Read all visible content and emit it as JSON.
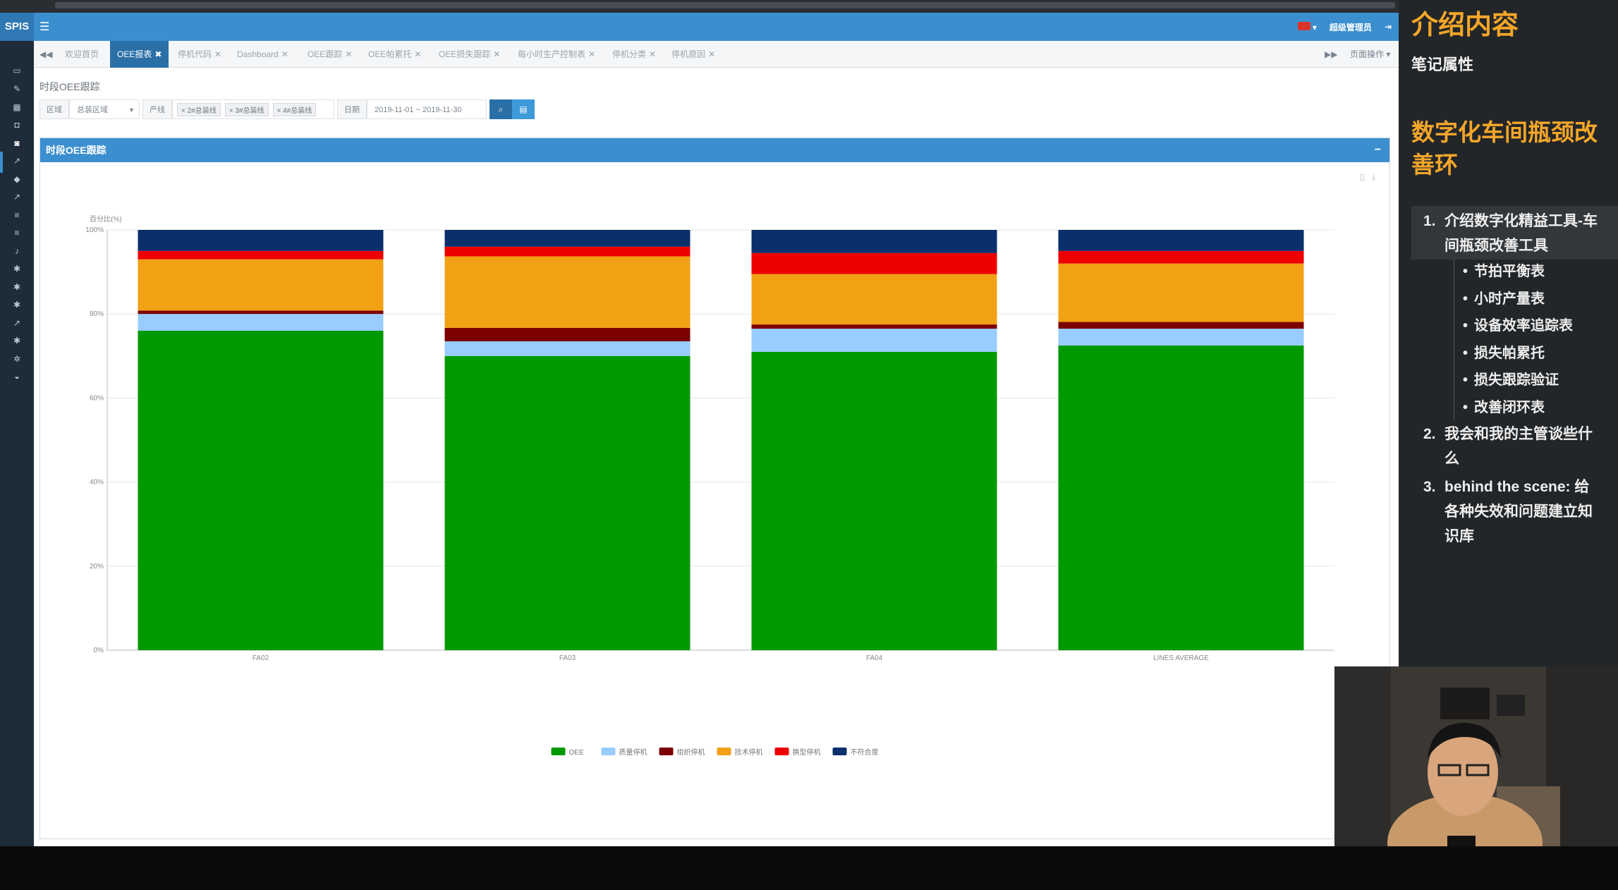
{
  "header": {
    "logo": "SPIS",
    "user": "超级管理员",
    "menu_icon": "menu-icon",
    "logout_icon": "logout-icon",
    "flag_color": "#d9342b"
  },
  "tabs": [
    {
      "label": "欢迎首页",
      "active": false
    },
    {
      "label": "OEE报表",
      "active": true
    },
    {
      "label": "停机代码",
      "active": false
    },
    {
      "label": "Dashboard",
      "active": false
    },
    {
      "label": "OEE跟踪",
      "active": false
    },
    {
      "label": "OEE帕累托",
      "active": false
    },
    {
      "label": "OEE损失跟踪",
      "active": false
    },
    {
      "label": "每小时生产控制表",
      "active": false
    },
    {
      "label": "停机分类",
      "active": false
    },
    {
      "label": "停机原因",
      "active": false
    }
  ],
  "tab_ops": "页面操作",
  "page": {
    "heading": "时段OEE跟踪",
    "filter": {
      "area_label": "区域",
      "area_value": "总装区域",
      "line_label": "产线",
      "lines": [
        "2#总装线",
        "3#总装线",
        "4#总装线"
      ],
      "date_label": "日期",
      "date_value": "2019-11-01 ~ 2019-11-30"
    },
    "panel_title": "时段OEE跟踪",
    "panel_minimize": "−"
  },
  "chart_data": {
    "type": "bar",
    "stacked": true,
    "ylabel": "百分比(%)",
    "ylim": [
      0,
      100
    ],
    "yticks": [
      "0%",
      "20%",
      "40%",
      "60%",
      "80%",
      "100%"
    ],
    "categories": [
      "FA02",
      "FA03",
      "FA04",
      "LINES AVERAGE"
    ],
    "series": [
      {
        "name": "OEE",
        "color": "#009900",
        "values": [
          76,
          70,
          71,
          72.5
        ]
      },
      {
        "name": "质量停机",
        "color": "#99ccff",
        "values": [
          4,
          3.5,
          5.5,
          4
        ]
      },
      {
        "name": "组织停机",
        "color": "#7b0000",
        "values": [
          0.8,
          3.2,
          1,
          1.6
        ]
      },
      {
        "name": "技术停机",
        "color": "#f2a014",
        "values": [
          12.2,
          17,
          12,
          13.9
        ]
      },
      {
        "name": "换型停机",
        "color": "#ee0000",
        "values": [
          2,
          2.3,
          5,
          3
        ]
      },
      {
        "name": "不符合度",
        "color": "#0a2f6b",
        "values": [
          5,
          4,
          5.5,
          5
        ]
      }
    ],
    "grid": true,
    "legend": "bottom-center"
  },
  "notes": {
    "title": "介绍内容",
    "subtitle": "笔记属性",
    "heading": "数字化车间瓶颈改善环",
    "items": [
      {
        "num": "1.",
        "text_l1": "介绍数字化精益工具-车",
        "text_l2": "间瓶颈改善工具",
        "subitems": [
          "节拍平衡表",
          "小时产量表",
          "设备效率追踪表",
          "损失帕累托",
          "损失跟踪验证",
          "改善闭环表"
        ]
      },
      {
        "num": "2.",
        "text_l1": "我会和我的主管谈些什",
        "text_l2": "么"
      },
      {
        "num": "3.",
        "text_l1": "behind the scene: 给",
        "text_l2": "各种失效和问题建立知",
        "text_l3": "识库"
      }
    ]
  }
}
